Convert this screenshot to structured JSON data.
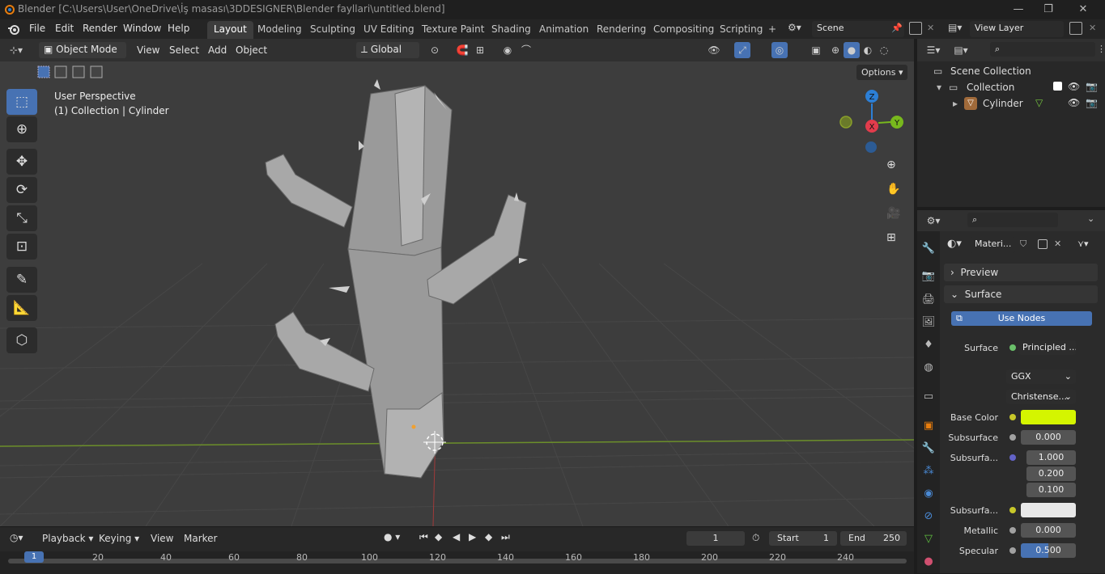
{
  "window": {
    "title": "Blender [C:\\Users\\User\\OneDrive\\İş masası\\3DDESIGNER\\Blender fayllari\\untitled.blend]",
    "min": "—",
    "max": "❐",
    "close": "✕"
  },
  "menu": {
    "items": [
      "File",
      "Edit",
      "Render",
      "Window",
      "Help"
    ],
    "workspaces": [
      "Layout",
      "Modeling",
      "Sculpting",
      "UV Editing",
      "Texture Paint",
      "Shading",
      "Animation",
      "Rendering",
      "Compositing",
      "Scripting"
    ],
    "active_workspace": "Layout",
    "add_tab": "+",
    "scene": "Scene",
    "view_layer": "View Layer"
  },
  "viewport_header": {
    "mode": "Object Mode",
    "menus": [
      "View",
      "Select",
      "Add",
      "Object"
    ],
    "transform_orientation": "Global",
    "options": "Options"
  },
  "viewport": {
    "overlay_line1": "User Perspective",
    "overlay_line2": "(1) Collection | Cylinder",
    "gizmo": {
      "z": "Z",
      "x": "X",
      "y": "Y"
    }
  },
  "timeline": {
    "menus": [
      "Playback",
      "Keying",
      "View",
      "Marker"
    ],
    "current_frame": "1",
    "start_label": "Start",
    "start": "1",
    "end_label": "End",
    "end": "250",
    "frame_marks": [
      "20",
      "40",
      "60",
      "80",
      "100",
      "120",
      "140",
      "160",
      "180",
      "200",
      "220",
      "240"
    ],
    "playhead": "1"
  },
  "outliner": {
    "scene_collection": "Scene Collection",
    "collection": "Collection",
    "object": "Cylinder"
  },
  "properties": {
    "material_name": "Materi...",
    "preview": "Preview",
    "surface_section": "Surface",
    "use_nodes": "Use Nodes",
    "surface_label": "Surface",
    "surface_value": "Principled ...",
    "distribution": "GGX",
    "subsurface_method": "Christense...",
    "rows": [
      {
        "label": "Base Color",
        "value": ""
      },
      {
        "label": "Subsurface",
        "value": "0.000"
      },
      {
        "label": "Subsurfa...",
        "value": "1.000"
      },
      {
        "label": "",
        "value": "0.200"
      },
      {
        "label": "",
        "value": "0.100"
      },
      {
        "label": "Subsurfa...",
        "value": ""
      },
      {
        "label": "Metallic",
        "value": "0.000"
      },
      {
        "label": "Specular",
        "value": "0.500"
      }
    ],
    "specular_fraction": 0.5
  },
  "colors": {
    "base_color": "#d4f500",
    "subsurface_color": "#e8e8e8",
    "accent": "#4772b3",
    "axis_x": "#e23c4c",
    "axis_y": "#78b81d",
    "axis_z": "#2c7fd6"
  }
}
